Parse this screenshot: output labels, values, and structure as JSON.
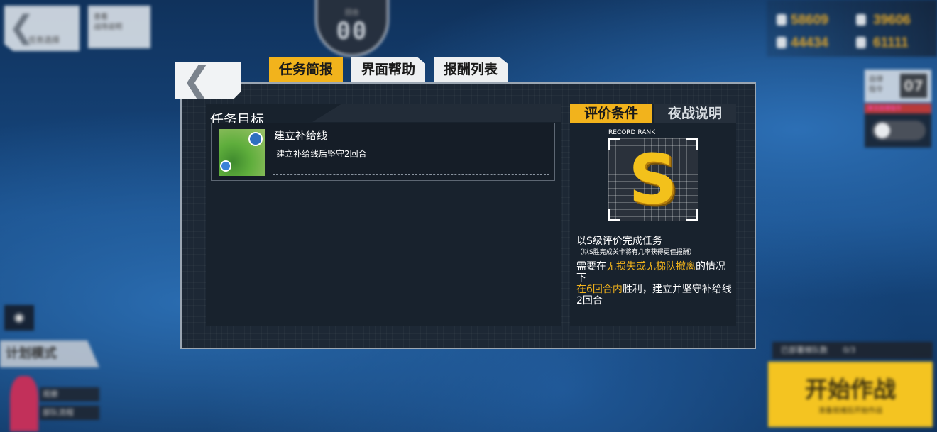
{
  "background": {
    "top_left": {
      "back_label": "任务选择",
      "second_label": "查看\n战场说明"
    },
    "round_counter": {
      "label": "回合",
      "value": "00"
    },
    "resources": [
      "58609",
      "39606",
      "44434",
      "61111"
    ],
    "right_widget": {
      "label": "自律\n指令",
      "value": "07",
      "red_label": "单次自律指令"
    },
    "plan_mode": "计划模式",
    "left_rows": [
      "观察",
      "部队流程"
    ],
    "enemy_label": "已部署梯队数",
    "enemy_value": "0/3",
    "start_button": {
      "label": "开始作战",
      "sub": "准备就绪后开始作战"
    }
  },
  "dialog": {
    "back_icon": "chevron-left-icon",
    "tabs": [
      {
        "label": "任务简报",
        "active": true
      },
      {
        "label": "界面帮助",
        "active": false
      },
      {
        "label": "报酬列表",
        "active": false
      }
    ],
    "mission": {
      "header": "任务目标",
      "objective_title": "建立补给线",
      "objective_desc": "建立补给线后坚守2回合"
    },
    "right_tabs": [
      {
        "label": "评价条件",
        "active": true
      },
      {
        "label": "夜战说明",
        "active": false
      }
    ],
    "rank": {
      "label": "RECORD RANK",
      "grade": "S",
      "title": "以S级评价完成任务",
      "note": "（以S胜完成关卡将有几率获得更佳报酬）",
      "desc_1": "需要在",
      "desc_hl_1": "无损失或无梯队撤离",
      "desc_2": "的情况下",
      "desc_hl_2": "在6回合内",
      "desc_3": "胜利，建立并坚守补给线2回合"
    }
  },
  "colors": {
    "accent": "#f2b31c",
    "panel": "#18222d"
  }
}
